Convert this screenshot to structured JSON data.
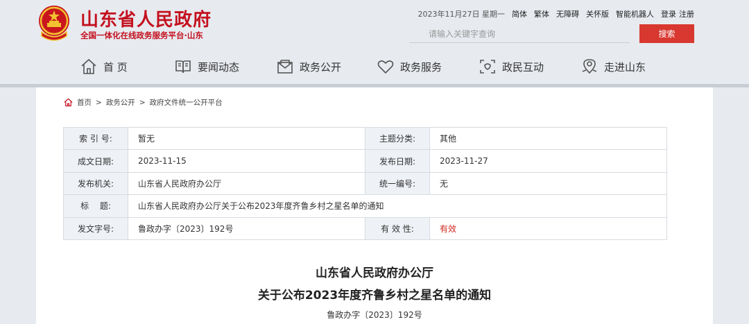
{
  "header": {
    "title": "山东省人民政府",
    "subtitle": "全国一体化在线政务服务平台·山东",
    "date": "2023年11月27日 星期一",
    "links": [
      "简体",
      "繁体",
      "无障碍",
      "关怀版",
      "智能机器人",
      "登录",
      "注册"
    ],
    "search_placeholder": "请输入关键字查询",
    "search_button": "搜索"
  },
  "nav": [
    {
      "label": "首 页",
      "icon": "home-icon"
    },
    {
      "label": "要闻动态",
      "icon": "book-icon"
    },
    {
      "label": "政务公开",
      "icon": "mail-icon"
    },
    {
      "label": "政务服务",
      "icon": "heart-icon"
    },
    {
      "label": "政民互动",
      "icon": "chat-icon"
    },
    {
      "label": "走进山东",
      "icon": "map-pin-icon"
    }
  ],
  "breadcrumb": [
    "首页",
    "政务公开",
    "政府文件统一公开平台"
  ],
  "meta": {
    "index_label": "索 引 号:",
    "index_value": "暂无",
    "topic_label": "主题分类:",
    "topic_value": "其他",
    "created_label": "成文日期:",
    "created_value": "2023-11-15",
    "published_label": "发布日期:",
    "published_value": "2023-11-27",
    "issuer_label": "发布机关:",
    "issuer_value": "山东省人民政府办公厅",
    "serial_label": "统一编号:",
    "serial_value": "无",
    "title_label": "标　 题:",
    "title_value": "山东省人民政府办公厅关于公布2023年度齐鲁乡村之星名单的通知",
    "docno_label": "发文字号:",
    "docno_value": "鲁政办字〔2023〕192号",
    "validity_label": "有 效 性:",
    "validity_value": "有效"
  },
  "document": {
    "title_line1": "山东省人民政府办公厅",
    "title_line2": "关于公布2023年度齐鲁乡村之星名单的通知",
    "number": "鲁政办字〔2023〕192号"
  },
  "colors": {
    "brand_red": "#c4101e",
    "search_button": "#d8382f",
    "validity": "#d12a1f"
  }
}
